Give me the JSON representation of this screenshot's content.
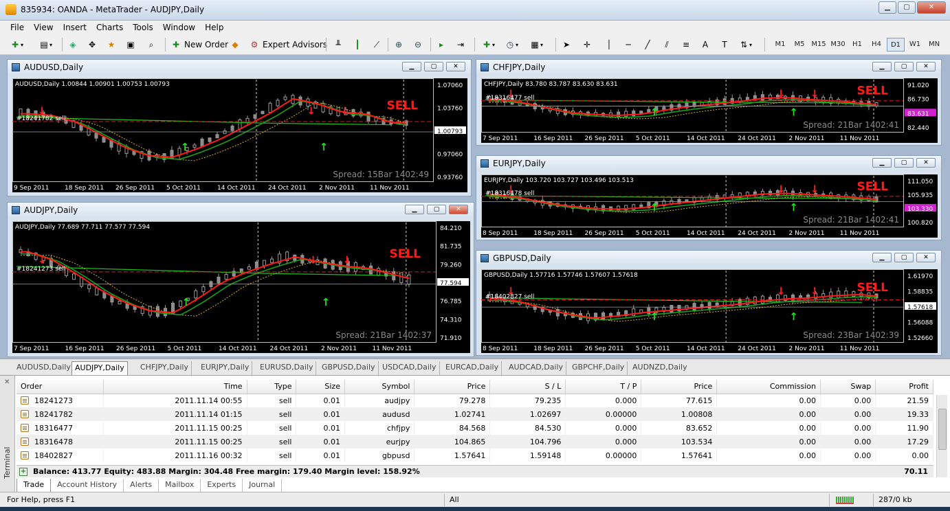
{
  "window": {
    "title": "835934: OANDA - MetaTrader - AUDJPY,Daily"
  },
  "menu": [
    "File",
    "View",
    "Insert",
    "Charts",
    "Tools",
    "Window",
    "Help"
  ],
  "toolbar": {
    "new_order": "New Order",
    "expert_advisors": "Expert Advisors",
    "timeframes": [
      "M1",
      "M5",
      "M15",
      "M30",
      "H1",
      "H4",
      "D1",
      "W1",
      "MN"
    ],
    "active_timeframe": "D1"
  },
  "colors": {
    "candle": "#808080",
    "ma_fast": "#ff1a1a",
    "ma_slow": "#18d018",
    "sell_label": "#ff1a1a",
    "bg": "#000000"
  },
  "charts": [
    {
      "id": "audusd",
      "window_title": "AUDUSD,Daily",
      "info": "AUDUSD,Daily  1.00844 1.00901 1.00753 1.00793",
      "order_label": "#18241782 sell",
      "signal": "SELL",
      "footer": "Spread: 15Bar  1402:49",
      "prices": [
        "1.07060",
        "1.03760",
        "1.00793",
        "0.97060",
        "0.93760"
      ],
      "current_price": "1.00793",
      "dates": [
        "9 Sep 2011",
        "18 Sep 2011",
        "26 Sep 2011",
        "5 Oct 2011",
        "14 Oct 2011",
        "24 Oct 2011",
        "2 Nov 2011",
        "11 Nov 2011"
      ]
    },
    {
      "id": "audjpy",
      "window_title": "AUDJPY,Daily",
      "info": "AUDJPY,Daily  77.689 77.711 77.577 77.594",
      "order_label": "#18241273 sell",
      "signal": "SELL",
      "footer": "Spread: 21Bar  1402:37",
      "prices": [
        "84.210",
        "81.735",
        "79.260",
        "77.594",
        "76.785",
        "74.310",
        "71.910"
      ],
      "current_price": "77.594",
      "dates": [
        "7 Sep 2011",
        "16 Sep 2011",
        "26 Sep 2011",
        "5 Oct 2011",
        "14 Oct 2011",
        "24 Oct 2011",
        "2 Nov 2011",
        "11 Nov 2011"
      ]
    },
    {
      "id": "chfjpy",
      "window_title": "CHFJPY,Daily",
      "info": "CHFJPY,Daily  83.780 83.787 83.630 83.631",
      "order_label": "#18316477 sell",
      "signal": "SELL",
      "footer": "Spread: 21Bar  1402:41",
      "prices": [
        "91.020",
        "86.730",
        "83.631",
        "82.440"
      ],
      "current_price": "83.631",
      "dates": [
        "7 Sep 2011",
        "16 Sep 2011",
        "26 Sep 2011",
        "5 Oct 2011",
        "14 Oct 2011",
        "24 Oct 2011",
        "2 Nov 2011",
        "11 Nov 2011"
      ]
    },
    {
      "id": "eurjpy",
      "window_title": "EURJPY,Daily",
      "info": "EURJPY,Daily  103.720 103.727 103.496 103.513",
      "order_label": "#18316478 sell",
      "signal": "SELL",
      "footer": "Spread: 21Bar  1402:41",
      "prices": [
        "111.050",
        "105.935",
        "103.330",
        "100.820"
      ],
      "current_price": "103.330",
      "dates": [
        "8 Sep 2011",
        "18 Sep 2011",
        "26 Sep 2011",
        "5 Oct 2011",
        "14 Oct 2011",
        "24 Oct 2011",
        "2 Nov 2011",
        "11 Nov 2011"
      ]
    },
    {
      "id": "gbpusd",
      "window_title": "GBPUSD,Daily",
      "info": "GBPUSD,Daily  1.57716 1.57746 1.57607 1.57618",
      "order_label": "#18402827 sell",
      "signal": "SELL",
      "footer": "Spread: 23Bar  1402:39",
      "prices": [
        "1.61970",
        "1.58835",
        "1.57618",
        "1.56088",
        "1.52660"
      ],
      "current_price": "1.57618",
      "dates": [
        "8 Sep 2011",
        "18 Sep 2011",
        "26 Sep 2011",
        "5 Oct 2011",
        "14 Oct 2011",
        "24 Oct 2011",
        "2 Nov 2011",
        "11 Nov 2011"
      ]
    }
  ],
  "chart_tabs": [
    "AUDUSD,Daily",
    "AUDJPY,Daily",
    "CHFJPY,Daily",
    "EURJPY,Daily",
    "EURUSD,Daily",
    "GBPUSD,Daily",
    "USDCAD,Daily",
    "EURCAD,Daily",
    "AUDCAD,Daily",
    "GBPCHF,Daily",
    "AUDNZD,Daily"
  ],
  "active_chart_tab": "AUDJPY,Daily",
  "terminal": {
    "label": "Terminal",
    "columns": [
      "Order",
      "Time",
      "Type",
      "Size",
      "Symbol",
      "Price",
      "S / L",
      "T / P",
      "Price",
      "Commission",
      "Swap",
      "Profit"
    ],
    "rows": [
      [
        "18241273",
        "2011.11.14 00:55",
        "sell",
        "0.01",
        "audjpy",
        "79.278",
        "79.235",
        "0.000",
        "77.615",
        "0.00",
        "0.00",
        "21.59"
      ],
      [
        "18241782",
        "2011.11.14 01:15",
        "sell",
        "0.01",
        "audusd",
        "1.02741",
        "1.02697",
        "0.00000",
        "1.00808",
        "0.00",
        "0.00",
        "19.33"
      ],
      [
        "18316477",
        "2011.11.15 00:25",
        "sell",
        "0.01",
        "chfjpy",
        "84.568",
        "84.530",
        "0.000",
        "83.652",
        "0.00",
        "0.00",
        "11.90"
      ],
      [
        "18316478",
        "2011.11.15 00:25",
        "sell",
        "0.01",
        "eurjpy",
        "104.865",
        "104.796",
        "0.000",
        "103.534",
        "0.00",
        "0.00",
        "17.29"
      ],
      [
        "18402827",
        "2011.11.16 00:32",
        "sell",
        "0.01",
        "gbpusd",
        "1.57641",
        "1.59148",
        "0.00000",
        "1.57641",
        "0.00",
        "0.00",
        "0.00"
      ]
    ],
    "balance_text": "Balance: 413.77  Equity: 483.88  Margin: 304.48  Free margin: 179.40  Margin level: 158.92%",
    "total_profit": "70.11",
    "tabs": [
      "Trade",
      "Account History",
      "Alerts",
      "Mailbox",
      "Experts",
      "Journal"
    ],
    "active_tab": "Trade"
  },
  "status": {
    "help": "For Help, press F1",
    "profile": "All",
    "traffic": "287/0 kb"
  }
}
